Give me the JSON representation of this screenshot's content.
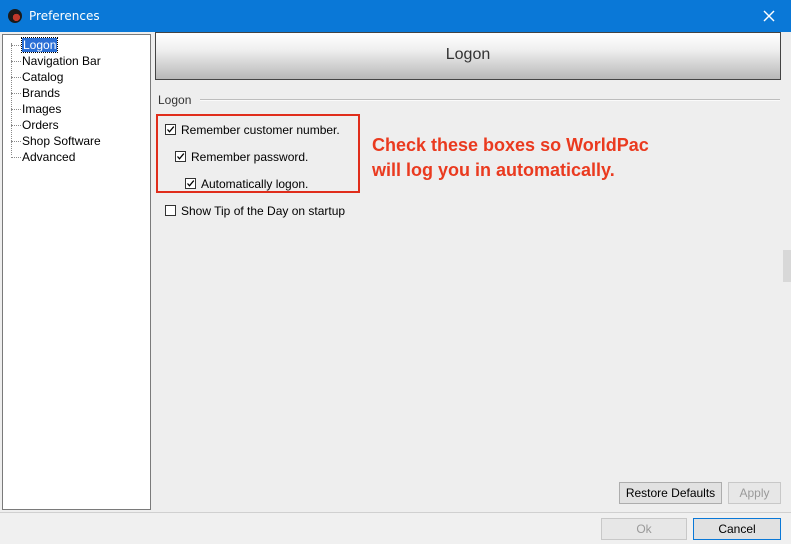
{
  "window": {
    "title": "Preferences"
  },
  "tree": {
    "items": [
      {
        "label": "Logon",
        "selected": true
      },
      {
        "label": "Navigation Bar"
      },
      {
        "label": "Catalog"
      },
      {
        "label": "Brands"
      },
      {
        "label": "Images"
      },
      {
        "label": "Orders"
      },
      {
        "label": "Shop Software"
      },
      {
        "label": "Advanced"
      }
    ]
  },
  "panel": {
    "banner_title": "Logon",
    "section_label": "Logon",
    "options": [
      {
        "label": "Remember customer number.",
        "checked": true
      },
      {
        "label": "Remember password.",
        "checked": true
      },
      {
        "label": "Automatically logon.",
        "checked": true
      },
      {
        "label": "Show Tip of the Day on startup",
        "checked": false
      }
    ]
  },
  "annotation": {
    "line1": "Check these boxes so WorldPac",
    "line2": "will log you in automatically.",
    "color": "#ea3a1f"
  },
  "buttons": {
    "restore_defaults": "Restore Defaults",
    "apply": "Apply",
    "ok": "Ok",
    "cancel": "Cancel"
  },
  "colors": {
    "titlebar": "#0a78d7",
    "selection": "#2a6fd6",
    "callout_border": "#e02d1b"
  }
}
